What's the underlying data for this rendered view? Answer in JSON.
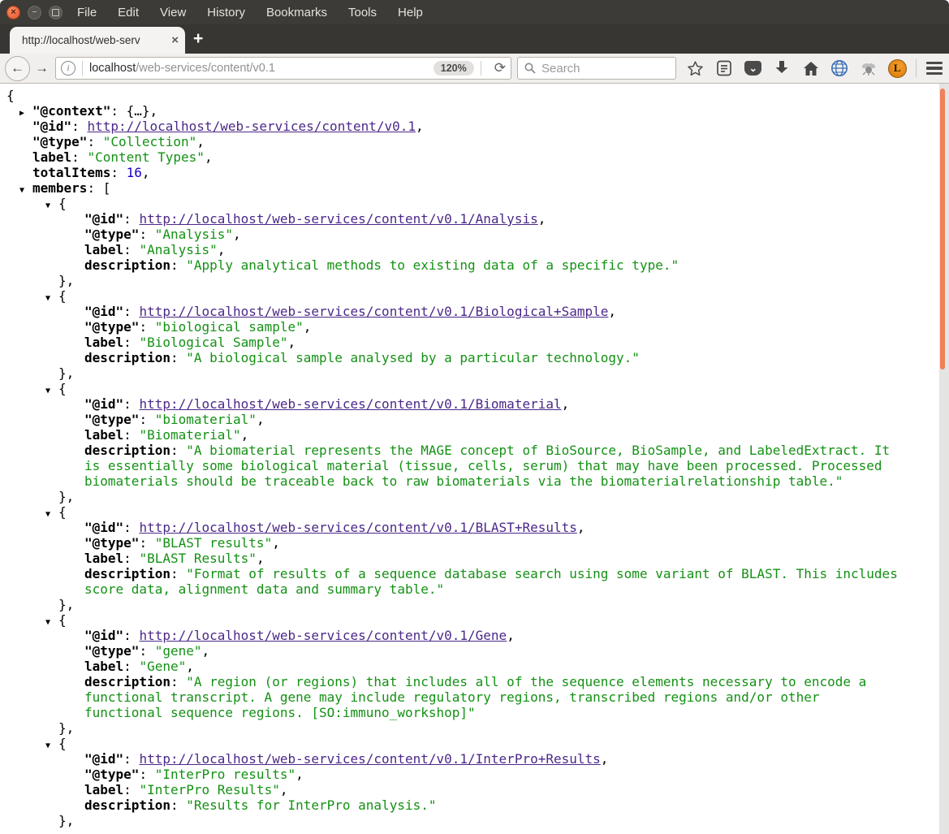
{
  "window": {
    "controls": {
      "close": "×",
      "minimize": "−"
    },
    "menu_items": [
      "File",
      "Edit",
      "View",
      "History",
      "Bookmarks",
      "Tools",
      "Help"
    ]
  },
  "tab": {
    "title": "http://localhost/web-serv",
    "close_label": "×",
    "new_tab_label": "+"
  },
  "navbar": {
    "back_arrow": "←",
    "forward_arrow": "→",
    "info_glyph": "i",
    "url_host": "localhost",
    "url_path": "/web-services/content/v0.1",
    "zoom_level": "120%",
    "reload_glyph": "⟳",
    "search_placeholder": "Search",
    "pocket_glyph": "⌄",
    "orange_ext_glyph": "L"
  },
  "colors": {
    "string_green": "#149114",
    "number_blue": "#1a01cc",
    "link_purple": "#4c2889",
    "scrollbar_orange": "#ef8058",
    "close_button_orange": "#e0572b",
    "chrome_dark": "#3c3b37"
  },
  "syntax": {
    "open_brace": "{",
    "close_brace_comma": "},",
    "open_bracket": "[",
    "colon": ": ",
    "comma": ",",
    "quote": "\"",
    "collapsed_triangle": "▶",
    "expanded_triangle": "▼"
  },
  "json_viewer": {
    "root": {
      "context_key": "\"@context\"",
      "context_value": "{…}",
      "id_key": "\"@id\"",
      "id_link": "http://localhost/web-services/content/v0.1",
      "type_key": "\"@type\"",
      "type_value": "\"Collection\"",
      "label_key": "label",
      "label_value": "\"Content Types\"",
      "total_key": "totalItems",
      "total_value": "16",
      "members_key": "members"
    },
    "member_keys": {
      "id": "\"@id\"",
      "type": "\"@type\"",
      "label": "label",
      "description": "description"
    },
    "members": [
      {
        "id": "http://localhost/web-services/content/v0.1/Analysis",
        "type": "Analysis",
        "label": "Analysis",
        "description": "Apply analytical methods to existing data of a specific type."
      },
      {
        "id": "http://localhost/web-services/content/v0.1/Biological+Sample",
        "type": "biological sample",
        "label": "Biological Sample",
        "description": "A biological sample analysed by a particular technology."
      },
      {
        "id": "http://localhost/web-services/content/v0.1/Biomaterial",
        "type": "biomaterial",
        "label": "Biomaterial",
        "description": "A biomaterial represents the MAGE concept of BioSource, BioSample, and LabeledExtract. It is essentially some biological material (tissue, cells, serum) that may have been processed. Processed biomaterials should be traceable back to raw biomaterials via the biomaterialrelationship table."
      },
      {
        "id": "http://localhost/web-services/content/v0.1/BLAST+Results",
        "type": "BLAST results",
        "label": "BLAST Results",
        "description": "Format of results of a sequence database search using some variant of BLAST. This includes score data, alignment data and summary table."
      },
      {
        "id": "http://localhost/web-services/content/v0.1/Gene",
        "type": "gene",
        "label": "Gene",
        "description": "A region (or regions) that includes all of the sequence elements necessary to encode a functional transcript. A gene may include regulatory regions, transcribed regions and/or other functional sequence regions. [SO:immuno_workshop]"
      },
      {
        "id": "http://localhost/web-services/content/v0.1/InterPro+Results",
        "type": "InterPro results",
        "label": "InterPro Results",
        "description": "Results for InterPro analysis."
      }
    ]
  }
}
